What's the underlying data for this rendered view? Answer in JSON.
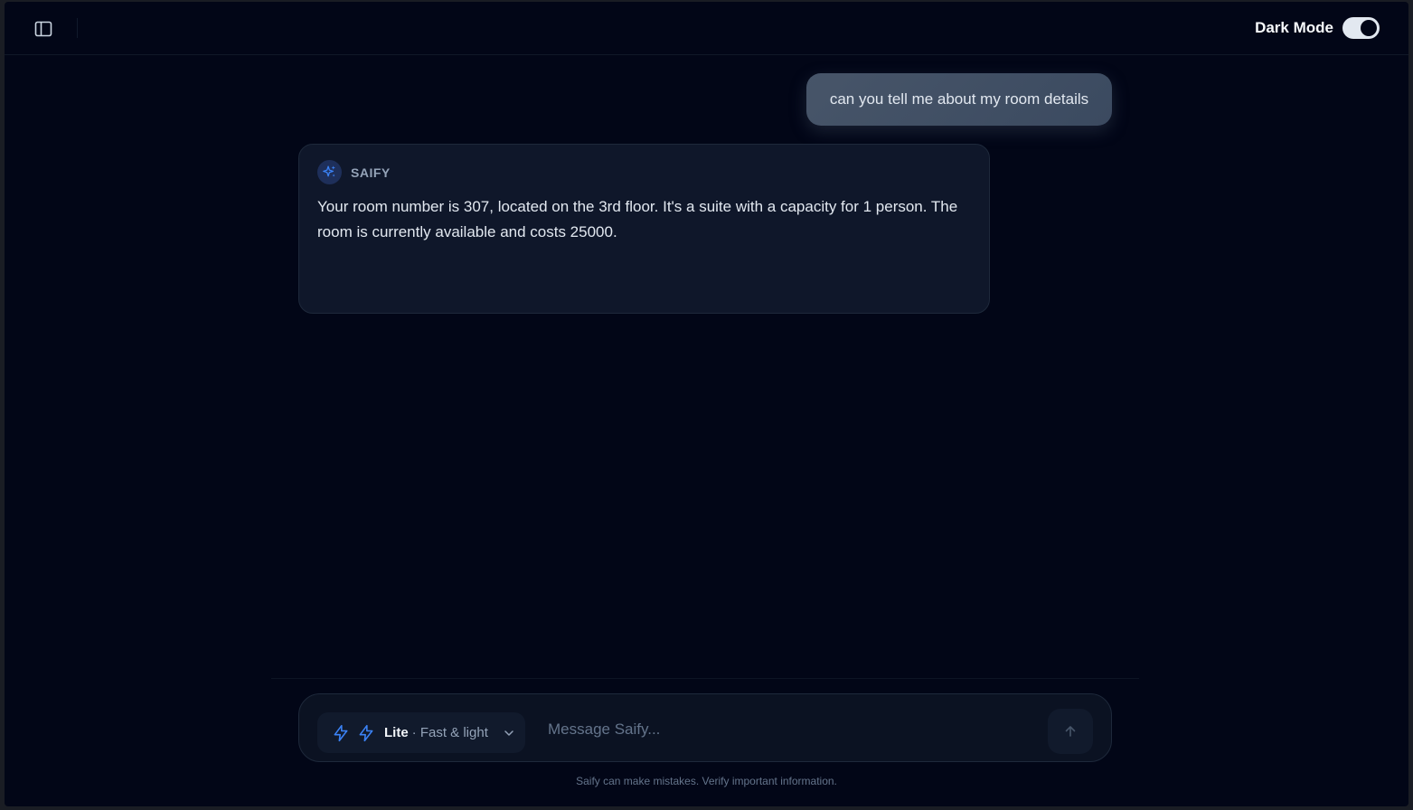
{
  "header": {
    "dark_mode_label": "Dark Mode",
    "dark_mode_on": true
  },
  "chat": {
    "user_message": "can you tell me about my room details",
    "assistant": {
      "name": "SAIFY",
      "message": "Your room number is 307, located on the 3rd floor. It's a suite with a capacity for 1 person. The room is currently available and costs 25000."
    }
  },
  "composer": {
    "model_name": "Lite",
    "model_desc": "· Fast & light",
    "placeholder": "Message Saify..."
  },
  "footer": {
    "disclaimer": "Saify can make mistakes. Verify important information."
  },
  "icons": {
    "sidebar_toggle": "sidebar-panel-icon",
    "assistant_avatar": "sparkles-icon",
    "model": "lightning-bolt-icon",
    "model_dropdown": "chevron-down-icon",
    "send": "arrow-up-icon"
  },
  "colors": {
    "background": "#020617",
    "user_bubble": "#475569",
    "assistant_card": "#0f172a",
    "accent": "#3b82f6"
  }
}
